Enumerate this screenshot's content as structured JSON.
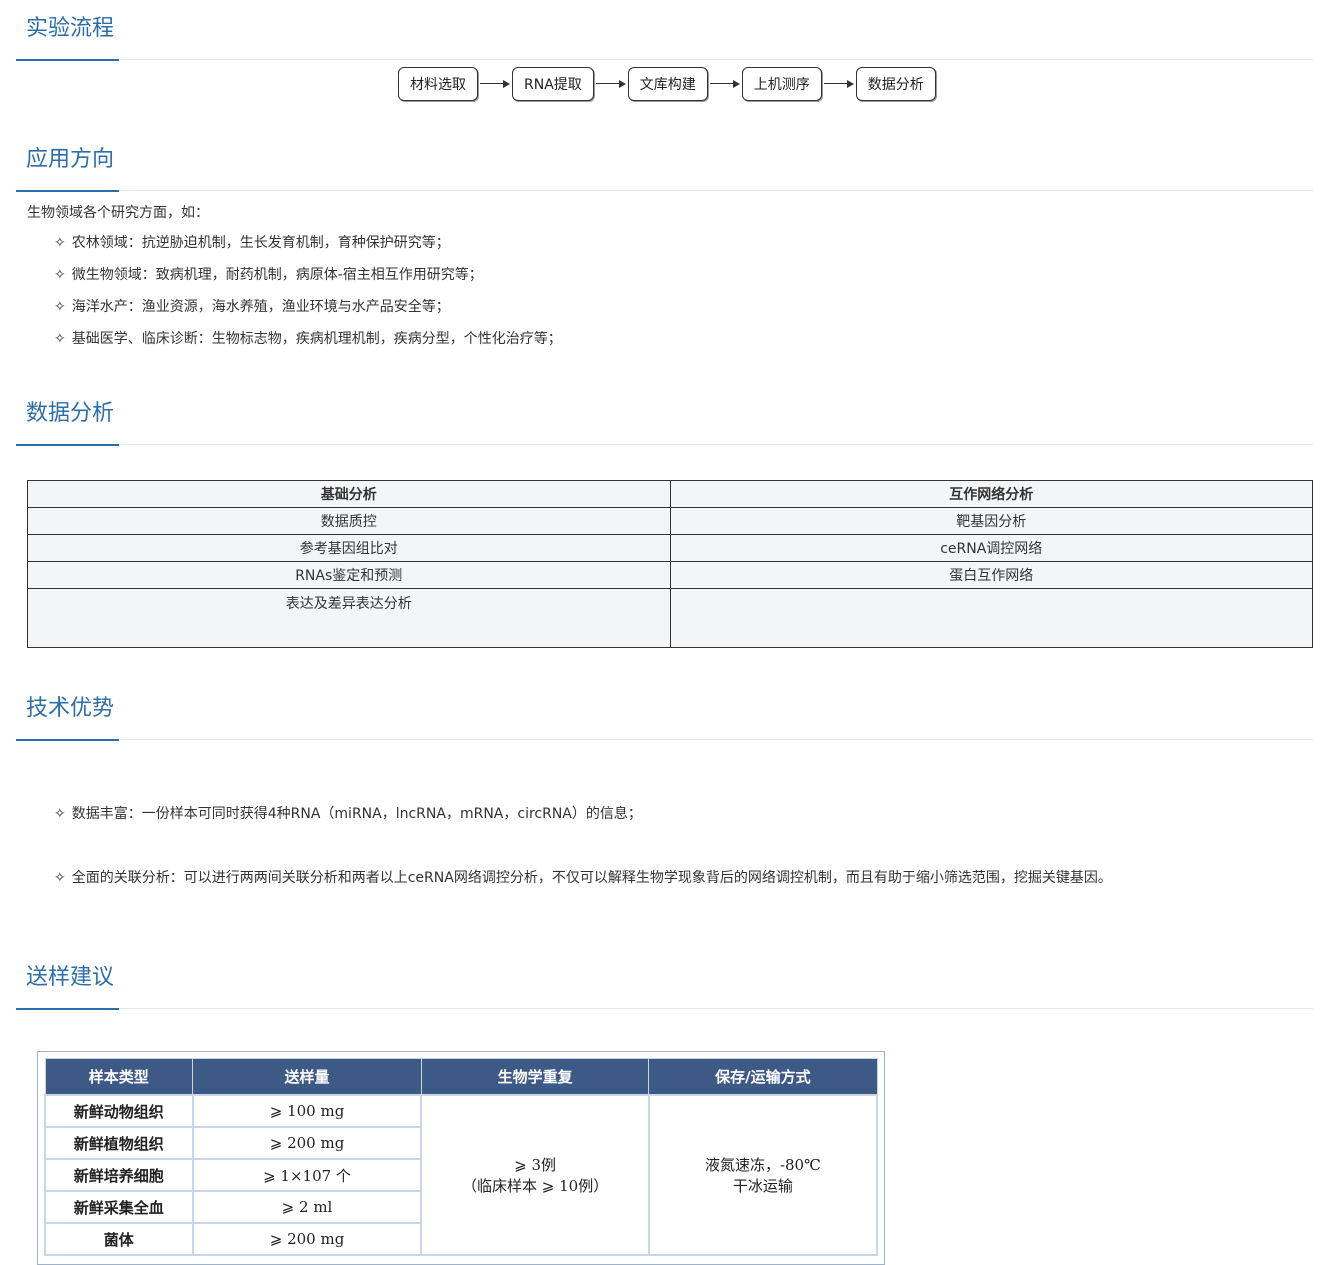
{
  "sections": {
    "process": "实验流程",
    "application": "应用方向",
    "analysis": "数据分析",
    "advantages": "技术优势",
    "sampling": "送样建议"
  },
  "flow_steps": [
    "材料选取",
    "RNA提取",
    "文库构建",
    "上机测序",
    "数据分析"
  ],
  "application": {
    "intro": "生物领域各个研究方面，如：",
    "items": [
      "农林领域：抗逆胁迫机制，生长发育机制，育种保护研究等；",
      "微生物领域：致病机理，耐药机制，病原体-宿主相互作用研究等；",
      "海洋水产：渔业资源，海水养殖，渔业环境与水产品安全等；",
      "基础医学、临床诊断：生物标志物，疾病机理机制，疾病分型，个性化治疗等；"
    ]
  },
  "bullet_symbol": "✧",
  "analysis_table": {
    "headers": [
      "基础分析",
      "互作网络分析"
    ],
    "rows": [
      [
        "数据质控",
        "靶基因分析"
      ],
      [
        "参考基因组比对",
        "ceRNA调控网络"
      ],
      [
        "RNAs鉴定和预测",
        "蛋白互作网络"
      ],
      [
        "表达及差异表达分析",
        ""
      ]
    ]
  },
  "advantages": [
    "数据丰富：一份样本可同时获得4种RNA（miRNA，lncRNA，mRNA，circRNA）的信息；",
    "全面的关联分析：可以进行两两间关联分析和两者以上ceRNA网络调控分析，不仅可以解释生物学现象背后的网络调控机制，而且有助于缩小筛选范围，挖掘关键基因。"
  ],
  "sample_table": {
    "headers": [
      "样本类型",
      "送样量",
      "生物学重复",
      "保存/运输方式"
    ],
    "rows": [
      [
        "新鲜动物组织",
        "⩾ 100 mg"
      ],
      [
        "新鲜植物组织",
        "⩾ 200 mg"
      ],
      [
        "新鲜培养细胞",
        "⩾ 1×107 个"
      ],
      [
        "新鲜采集全血",
        "⩾ 2 ml"
      ],
      [
        "菌体",
        "⩾ 200 mg"
      ]
    ],
    "replicates_line1": "⩾ 3例",
    "replicates_line2": "（临床样本 ⩾ 10例）",
    "storage_line1": "液氮速冻，-80℃",
    "storage_line2": "干冰运输"
  },
  "colors": {
    "accent": "#2c6ea8",
    "table_header": "#3d5a87"
  }
}
